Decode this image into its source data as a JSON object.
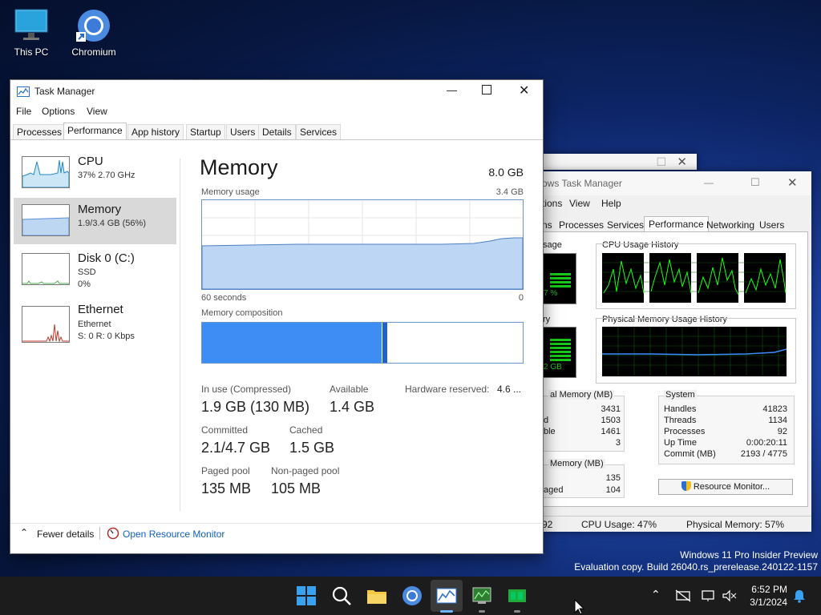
{
  "desktop": {
    "icons": [
      {
        "label": "This PC"
      },
      {
        "label": "Chromium"
      }
    ],
    "watermark_line1": "Windows 11 Pro Insider Preview",
    "watermark_line2": "Evaluation copy. Build 26040.rs_prerelease.240122-1157"
  },
  "task_manager": {
    "title": "Task Manager",
    "menu": [
      "File",
      "Options",
      "View"
    ],
    "tabs": [
      "Processes",
      "Performance",
      "App history",
      "Startup",
      "Users",
      "Details",
      "Services"
    ],
    "sidebar": [
      {
        "title": "CPU",
        "sub1": "37%  2.70 GHz",
        "sub2": "",
        "sub3": ""
      },
      {
        "title": "Memory",
        "sub1": "1.9/3.4 GB (56%)",
        "sub2": "",
        "sub3": ""
      },
      {
        "title": "Disk 0 (C:)",
        "sub1": "SSD",
        "sub2": "0%",
        "sub3": ""
      },
      {
        "title": "Ethernet",
        "sub1": "Ethernet",
        "sub2": "S: 0  R: 0 Kbps",
        "sub3": ""
      }
    ],
    "main": {
      "heading": "Memory",
      "total": "8.0 GB",
      "usage_label": "Memory usage",
      "usage_max": "3.4 GB",
      "axis_left": "60 seconds",
      "axis_right": "0",
      "composition_label": "Memory composition",
      "composition_in_use_fraction": 0.56,
      "stats": {
        "in_use_label": "In use (Compressed)",
        "in_use_value": "1.9 GB (130 MB)",
        "available_label": "Available",
        "available_value": "1.4 GB",
        "hw_reserved_label": "Hardware reserved:",
        "hw_reserved_value": "4.6 ...",
        "committed_label": "Committed",
        "committed_value": "2.1/4.7 GB",
        "cached_label": "Cached",
        "cached_value": "1.5 GB",
        "paged_label": "Paged pool",
        "paged_value": "135 MB",
        "nonpaged_label": "Non-paged pool",
        "nonpaged_value": "105 MB"
      }
    },
    "footer": {
      "fewer_details": "Fewer details",
      "open_monitor": "Open Resource Monitor"
    }
  },
  "classic_tm": {
    "title": "ows Task Manager",
    "menu": [
      "tions",
      "View",
      "Help"
    ],
    "tabs": [
      "ns",
      "Processes",
      "Services",
      "Performance",
      "Networking",
      "Users"
    ],
    "cpu_usage_label": "sage",
    "cpu_usage_value": "7 %",
    "cpu_history_label": "CPU Usage History",
    "mem_label": "ry",
    "mem_value": "2 GB",
    "phys_history_label": "Physical Memory Usage History",
    "phys_mem_box": {
      "label": "al Memory (MB)",
      "rows": [
        {
          "k": "",
          "v": "3431"
        },
        {
          "k": "d",
          "v": "1503"
        },
        {
          "k": "ble",
          "v": "1461"
        },
        {
          "k": "",
          "v": "3"
        }
      ]
    },
    "kernel_box": {
      "label": "Memory (MB)",
      "rows": [
        {
          "k": "",
          "v": "135"
        },
        {
          "k": "aged",
          "v": "104"
        }
      ]
    },
    "system_box": {
      "label": "System",
      "rows": [
        {
          "k": "Handles",
          "v": "41823"
        },
        {
          "k": "Threads",
          "v": "1134"
        },
        {
          "k": "Processes",
          "v": "92"
        },
        {
          "k": "Up Time",
          "v": "0:00:20:11"
        },
        {
          "k": "Commit (MB)",
          "v": "2193 / 4775"
        }
      ]
    },
    "resource_monitor_button": "Resource Monitor...",
    "status": {
      "processes": "92",
      "cpu": "CPU Usage: 47%",
      "physical": "Physical Memory: 57%"
    }
  },
  "taskbar": {
    "time": "6:52 PM",
    "date": "3/1/2024"
  }
}
